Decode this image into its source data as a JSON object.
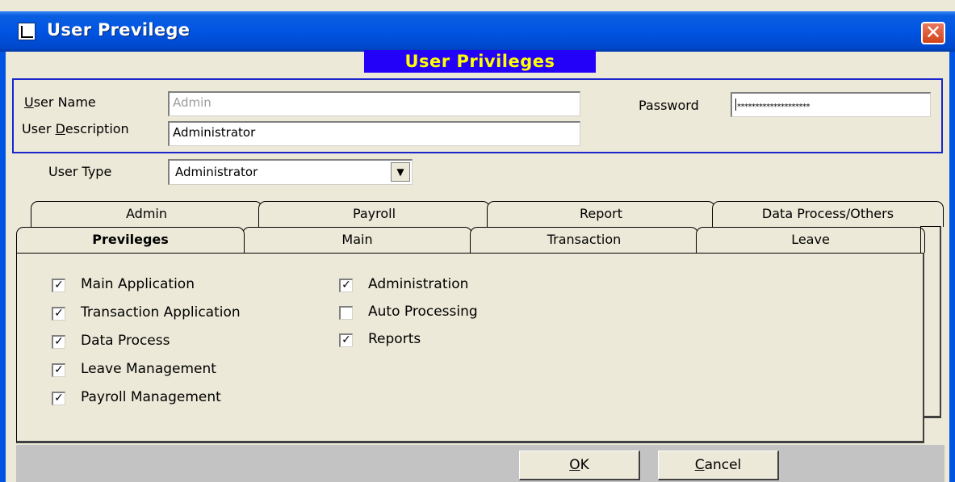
{
  "window": {
    "title": "User Previlege",
    "close_label": "✕"
  },
  "banner": {
    "text": "User Privileges"
  },
  "form": {
    "user_name_label_1": "U",
    "user_name_label_2": "ser Name",
    "user_name_value": "Admin",
    "user_description_label_1": "User ",
    "user_description_label_2": "D",
    "user_description_label_3": "escription",
    "user_description_value": "Administrator",
    "password_label": "Password",
    "password_value": "********************",
    "user_type_label": "User Type",
    "user_type_value": "Administrator"
  },
  "tabs_back": [
    {
      "label": "Admin"
    },
    {
      "label": "Payroll"
    },
    {
      "label": "Report"
    },
    {
      "label": "Data Process/Others"
    }
  ],
  "tabs_front": [
    {
      "label": "Previleges"
    },
    {
      "label": "Main"
    },
    {
      "label": "Transaction"
    },
    {
      "label": "Leave"
    }
  ],
  "privileges_left": [
    {
      "label": "Main Application",
      "checked": "✓"
    },
    {
      "label": "Transaction Application",
      "checked": "✓"
    },
    {
      "label": "Data Process",
      "checked": "✓"
    },
    {
      "label": "Leave Management",
      "checked": "✓"
    },
    {
      "label": "Payroll Management",
      "checked": "✓"
    }
  ],
  "privileges_right": [
    {
      "label": "Administration",
      "checked": "✓"
    },
    {
      "label": "Auto Processing",
      "checked": ""
    },
    {
      "label": "Reports",
      "checked": "✓"
    }
  ],
  "buttons": {
    "ok_1": "O",
    "ok_2": "K",
    "cancel_1": "C",
    "cancel_2": "ancel"
  }
}
